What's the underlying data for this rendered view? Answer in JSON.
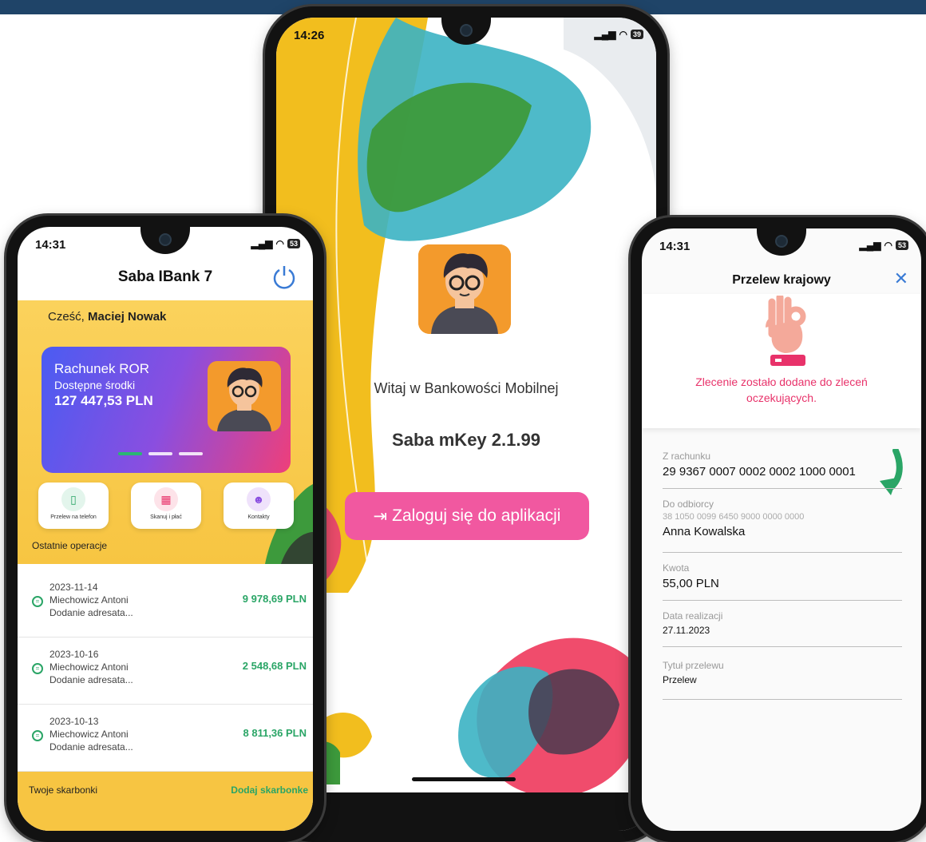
{
  "phone1": {
    "time": "14:31",
    "battery": "53",
    "app_title": "Saba IBank 7",
    "greeting": "Cześć,",
    "user_name": "Maciej Nowak",
    "account": {
      "name": "Rachunek ROR",
      "balance_label": "Dostępne środki",
      "balance": "127 447,53 PLN"
    },
    "actions": [
      {
        "label": "Przelew na telefon"
      },
      {
        "label": "Skanuj i płać"
      },
      {
        "label": "Kontakty"
      }
    ],
    "recent_label": "Ostatnie operacje",
    "operations": [
      {
        "date": "2023-11-14",
        "name": "Miechowicz Antoni",
        "desc": "Dodanie adresata...",
        "amount": "9 978,69 PLN"
      },
      {
        "date": "2023-10-16",
        "name": "Miechowicz Antoni",
        "desc": "Dodanie adresata...",
        "amount": "2 548,68 PLN"
      },
      {
        "date": "2023-10-13",
        "name": "Miechowicz Antoni",
        "desc": "Dodanie adresata...",
        "amount": "8 811,36 PLN"
      }
    ],
    "piggy_label": "Twoje skarbonki",
    "piggy_add": "Dodaj skarbonke"
  },
  "phone2": {
    "time": "14:26",
    "battery": "39",
    "welcome": "Witaj w Bankowości Mobilnej",
    "app_version": "Saba mKey 2.1.99",
    "login_button": "Zaloguj się do aplikacji"
  },
  "phone3": {
    "time": "14:31",
    "battery": "53",
    "title": "Przelew krajowy",
    "message": "Zlecenie zostało dodane do zleceń oczekujących.",
    "from_label": "Z rachunku",
    "from_value": "29 9367 0007 0002 0002 1000 0001",
    "to_label": "Do odbiorcy",
    "to_account": "38 1050 0099 6450 9000 0000 0000",
    "to_name": "Anna Kowalska",
    "amount_label": "Kwota",
    "amount_value": "55,00 PLN",
    "date_label": "Data realizacji",
    "date_value": "27.11.2023",
    "title_label": "Tytuł przelewu",
    "title_value": "Przelew"
  },
  "colors": {
    "topbar": "#1f4468",
    "accent_pink": "#f158a0",
    "success_green": "#2aa566",
    "yellow": "#f7c542",
    "teal": "#3bb3c3"
  }
}
